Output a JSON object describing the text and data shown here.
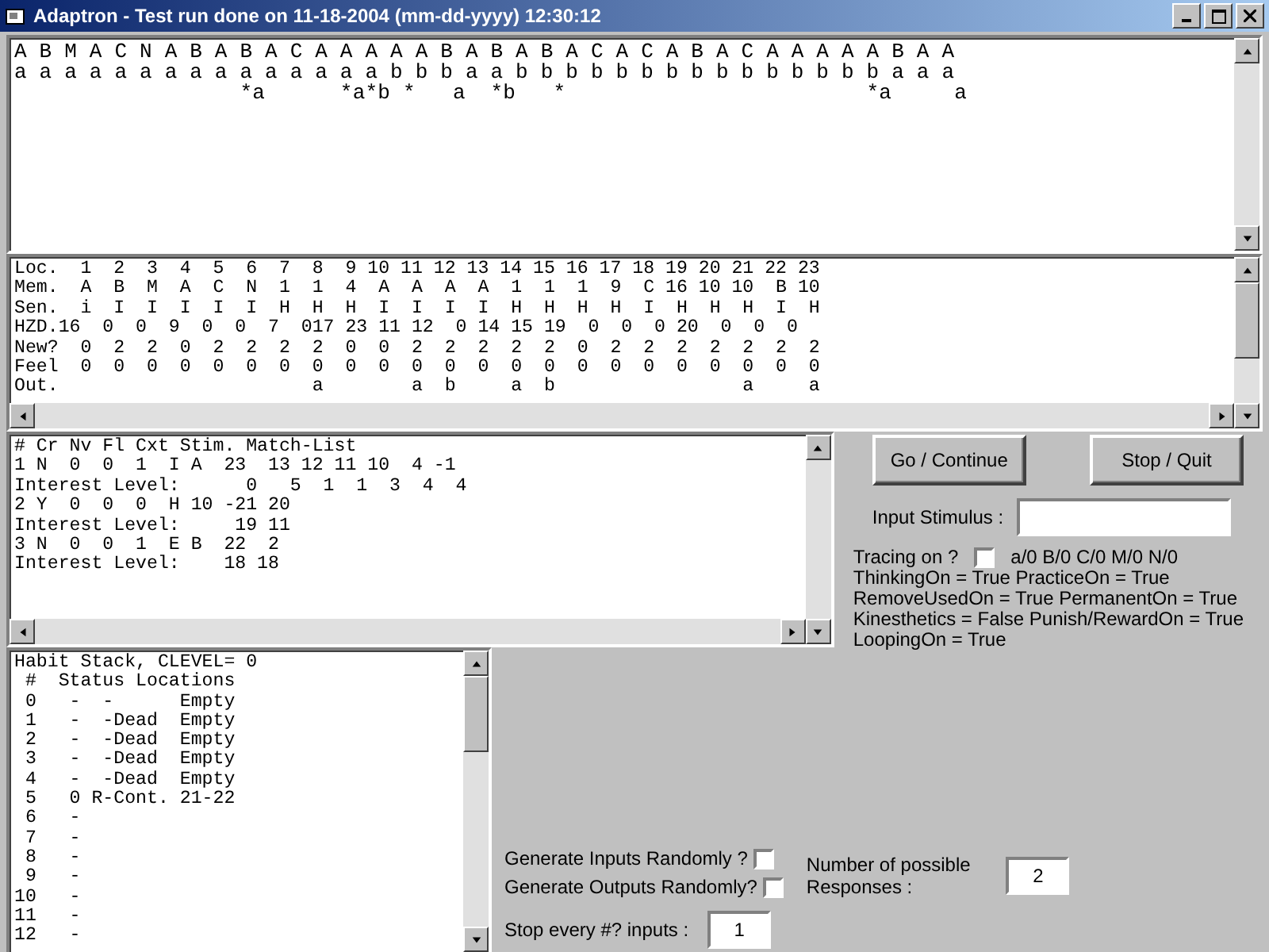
{
  "window": {
    "title": "Adaptron - Test run done on 11-18-2004 (mm-dd-yyyy) 12:30:12"
  },
  "sequence_view": {
    "lines": [
      "A B M A C N A B A B A C A A A A A B A B A B A C A C A B A C A A A A A B A A",
      "a a a a a a a a a a a a a a a b b b a a b b b b b b b b b b b b b b b a a a",
      "                  *a      *a*b *   a  *b   *                        *a     a"
    ]
  },
  "location_table": {
    "lines": [
      "Loc.  1  2  3  4  5  6  7  8  9 10 11 12 13 14 15 16 17 18 19 20 21 22 23",
      "Mem.  A  B  M  A  C  N  1  1  4  A  A  A  A  1  1  1  9  C 16 10 10  B 10",
      "Sen.  i  I  I  I  I  I  H  H  H  I  I  I  I  H  H  H  H  I  H  H  H  I  H",
      "HZD.16  0  0  9  0  0  7  017 23 11 12  0 14 15 19  0  0  0 20  0  0  0",
      "New?  0  2  2  0  2  2  2  2  0  0  2  2  2  2  2  0  2  2  2  2  2  2  2",
      "Feel  0  0  0  0  0  0  0  0  0  0  0  0  0  0  0  0  0  0  0  0  0  0  0",
      "Out.                       a        a  b     a  b                 a     a"
    ]
  },
  "match_list": {
    "lines": [
      "# Cr Nv Fl Cxt Stim. Match-List",
      "1 N  0  0  1  I A  23  13 12 11 10  4 -1",
      "Interest Level:      0   5  1  1  3  4  4",
      "2 Y  0  0  0  H 10 -21 20",
      "Interest Level:     19 11",
      "3 N  0  0  1  E B  22  2",
      "Interest Level:    18 18"
    ]
  },
  "habit_stack": {
    "lines": [
      "Habit Stack, CLEVEL= 0",
      " #  Status Locations",
      " 0   -  -      Empty",
      " 1   -  -Dead  Empty",
      " 2   -  -Dead  Empty",
      " 3   -  -Dead  Empty",
      " 4   -  -Dead  Empty",
      " 5   0 R-Cont. 21-22",
      " 6   -",
      " 7   -",
      " 8   -",
      " 9   -",
      "10   -",
      "11   -",
      "12   -"
    ]
  },
  "buttons": [
    {
      "label": "Go / Continue"
    },
    {
      "label": "Stop / Quit"
    }
  ],
  "input_stimulus": {
    "label": "Input Stimulus :"
  },
  "tracing": {
    "label": "Tracing on ?",
    "checked": false,
    "options": "a/0  B/0  C/0  M/0  N/0"
  },
  "settings": [
    "ThinkingOn = True PracticeOn = True",
    "RemoveUsedOn = True PermanentOn = True",
    "Kinesthetics = False Punish/RewardOn = True",
    "LoopingOn = True"
  ],
  "generate_inputs": {
    "label": "Generate Inputs Randomly ?",
    "checked": false
  },
  "generate_outputs": {
    "label": "Generate Outputs Randomly?",
    "checked": false
  },
  "responses": {
    "label": "Number of possible Responses :",
    "value": "2"
  },
  "stop_every": {
    "label": "Stop every #? inputs :",
    "value": "1"
  }
}
